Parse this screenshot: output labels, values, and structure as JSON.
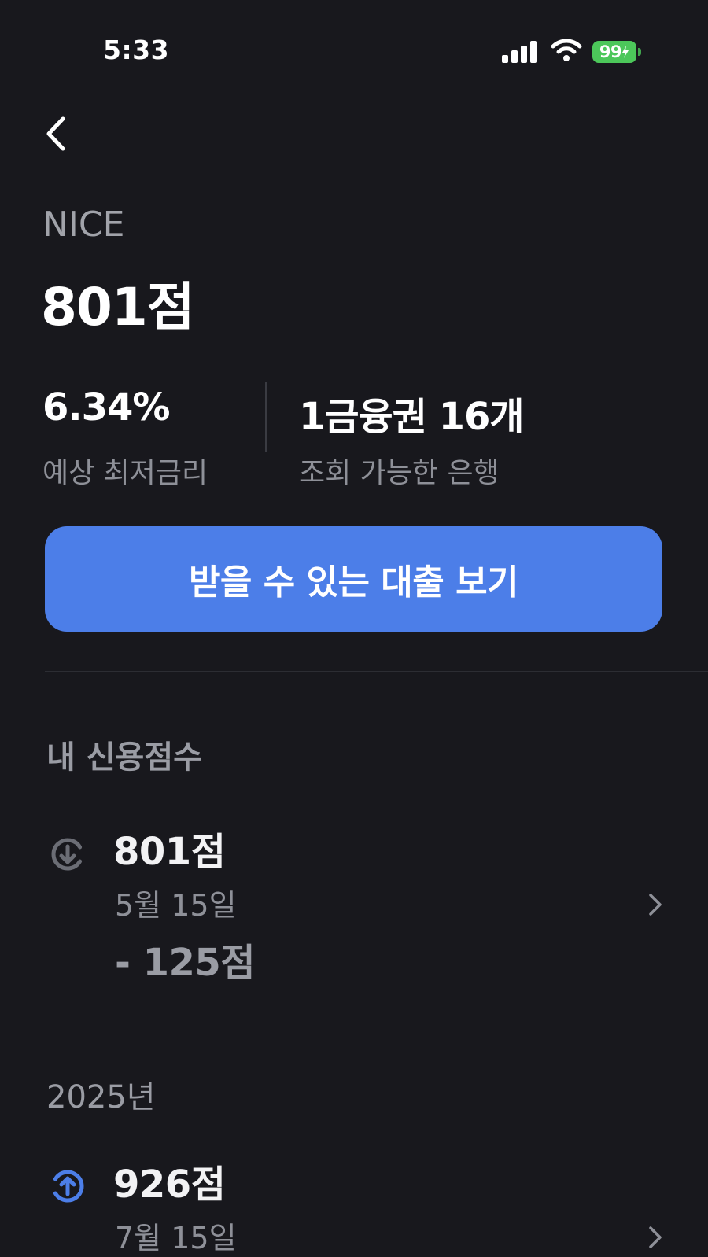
{
  "status_bar": {
    "time": "5:33",
    "battery": "99"
  },
  "header": {
    "bureau": "NICE",
    "score": "801점"
  },
  "stats": {
    "min_rate_value": "6.34%",
    "min_rate_label": "예상 최저금리",
    "banks_value": "1금융권 16개",
    "banks_label": "조회 가능한 은행"
  },
  "cta": {
    "label": "받을 수 있는 대출 보기"
  },
  "section": {
    "title": "내 신용점수"
  },
  "history": [
    {
      "score": "801점",
      "date": "5월 15일",
      "change": "- 125점",
      "direction": "down",
      "icon": "arrow-down-circle-icon"
    },
    {
      "score": "926점",
      "date": "7월 15일",
      "direction": "up",
      "icon": "arrow-up-circle-icon"
    }
  ],
  "year_group": "2025년",
  "colors": {
    "background": "#18181d",
    "accent": "#4c7ee8",
    "up": "#4c7ee8",
    "down": "#6b6d75",
    "battery": "#4cc75a"
  }
}
